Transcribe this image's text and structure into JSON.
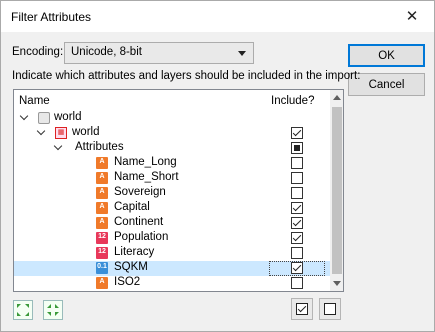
{
  "window": {
    "title": "Filter Attributes",
    "close_glyph": "✕"
  },
  "encoding": {
    "label": "Encoding:",
    "value": "Unicode, 8-bit"
  },
  "instruction": "Indicate which attributes and layers should be included in the import:",
  "buttons": {
    "ok": "OK",
    "cancel": "Cancel"
  },
  "tree": {
    "headers": {
      "name": "Name",
      "include": "Include?"
    },
    "rows": [
      {
        "label": "world",
        "icon": "database-icon",
        "state": "none"
      },
      {
        "label": "world",
        "icon": "layer-icon",
        "state": "checked"
      },
      {
        "label": "Attributes",
        "icon": "",
        "state": "partial"
      },
      {
        "label": "Name_Long",
        "icon": "text-field-icon",
        "icon_text": "A",
        "state": "unchecked"
      },
      {
        "label": "Name_Short",
        "icon": "text-field-icon",
        "icon_text": "A",
        "state": "unchecked"
      },
      {
        "label": "Sovereign",
        "icon": "text-field-icon",
        "icon_text": "A",
        "state": "unchecked"
      },
      {
        "label": "Capital",
        "icon": "text-field-icon",
        "icon_text": "A",
        "state": "checked"
      },
      {
        "label": "Continent",
        "icon": "text-field-icon",
        "icon_text": "A",
        "state": "checked"
      },
      {
        "label": "Population",
        "icon": "integer-field-icon",
        "icon_text": "12",
        "state": "checked"
      },
      {
        "label": "Literacy",
        "icon": "integer-field-icon",
        "icon_text": "12",
        "state": "unchecked"
      },
      {
        "label": "SQKM",
        "icon": "decimal-field-icon",
        "icon_text": "0.1",
        "state": "checked",
        "selected": true
      },
      {
        "label": "ISO2",
        "icon": "text-field-icon",
        "icon_text": "A",
        "state": "unchecked"
      }
    ]
  },
  "toolbar": {
    "expand_all_icon": "expand-all-icon",
    "collapse_all_icon": "collapse-all-icon",
    "check_all_icon": "check-all-icon",
    "uncheck_all_icon": "uncheck-all-icon"
  }
}
